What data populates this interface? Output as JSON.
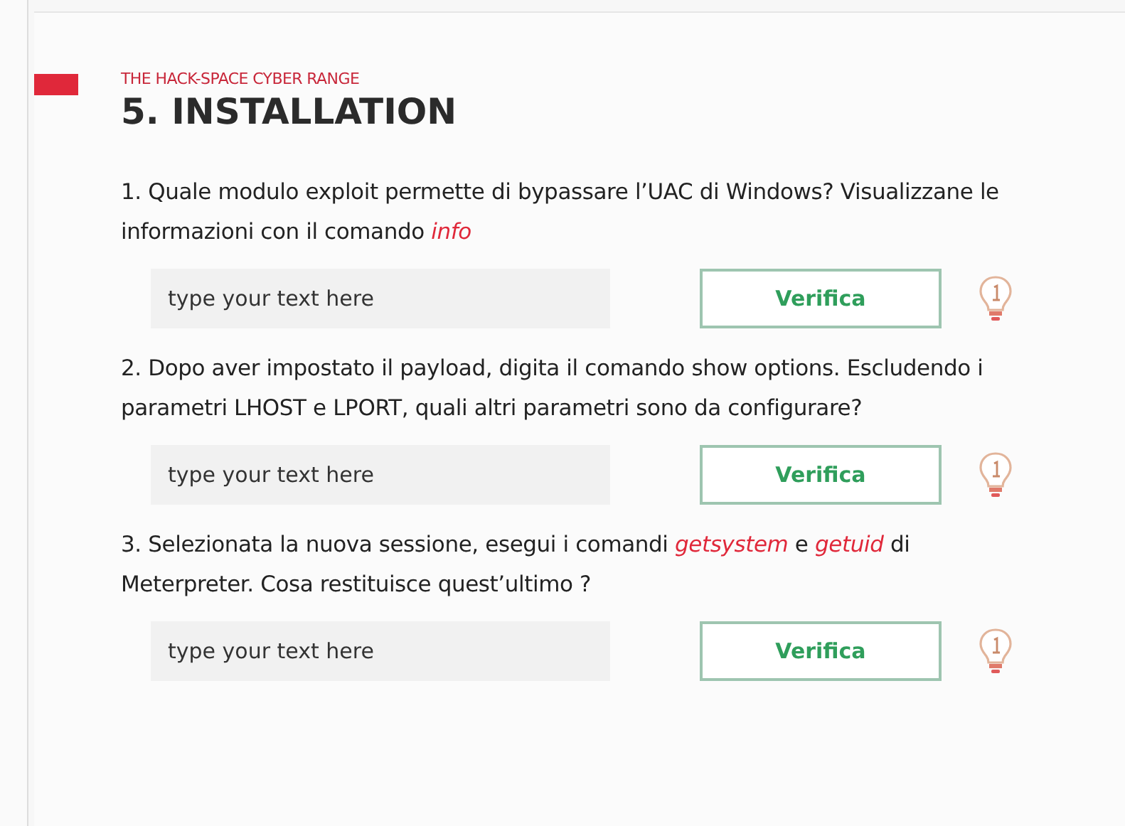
{
  "header": {
    "kicker": "THE HACK-SPACE CYBER RANGE",
    "title": "5. INSTALLATION"
  },
  "questions": [
    {
      "text": "1.  Quale modulo exploit permette di bypassare l’UAC di Windows? Visualizzane le informazioni con il comando *info*",
      "placeholder": "type your text here",
      "button": "Verifica"
    },
    {
      "text": "2. Dopo aver impostato il payload, digita il comando show options. Escludendo i parametri LHOST e LPORT, quali altri parametri sono da configurare?",
      "placeholder": "type your text here",
      "button": "Verifica"
    },
    {
      "text": "3. Selezionata la nuova sessione, esegui i comandi *getsystem* e *getuid* di Meterpreter. Cosa restituisce quest’ultimo ?",
      "placeholder": "type your text here",
      "button": "Verifica"
    }
  ]
}
